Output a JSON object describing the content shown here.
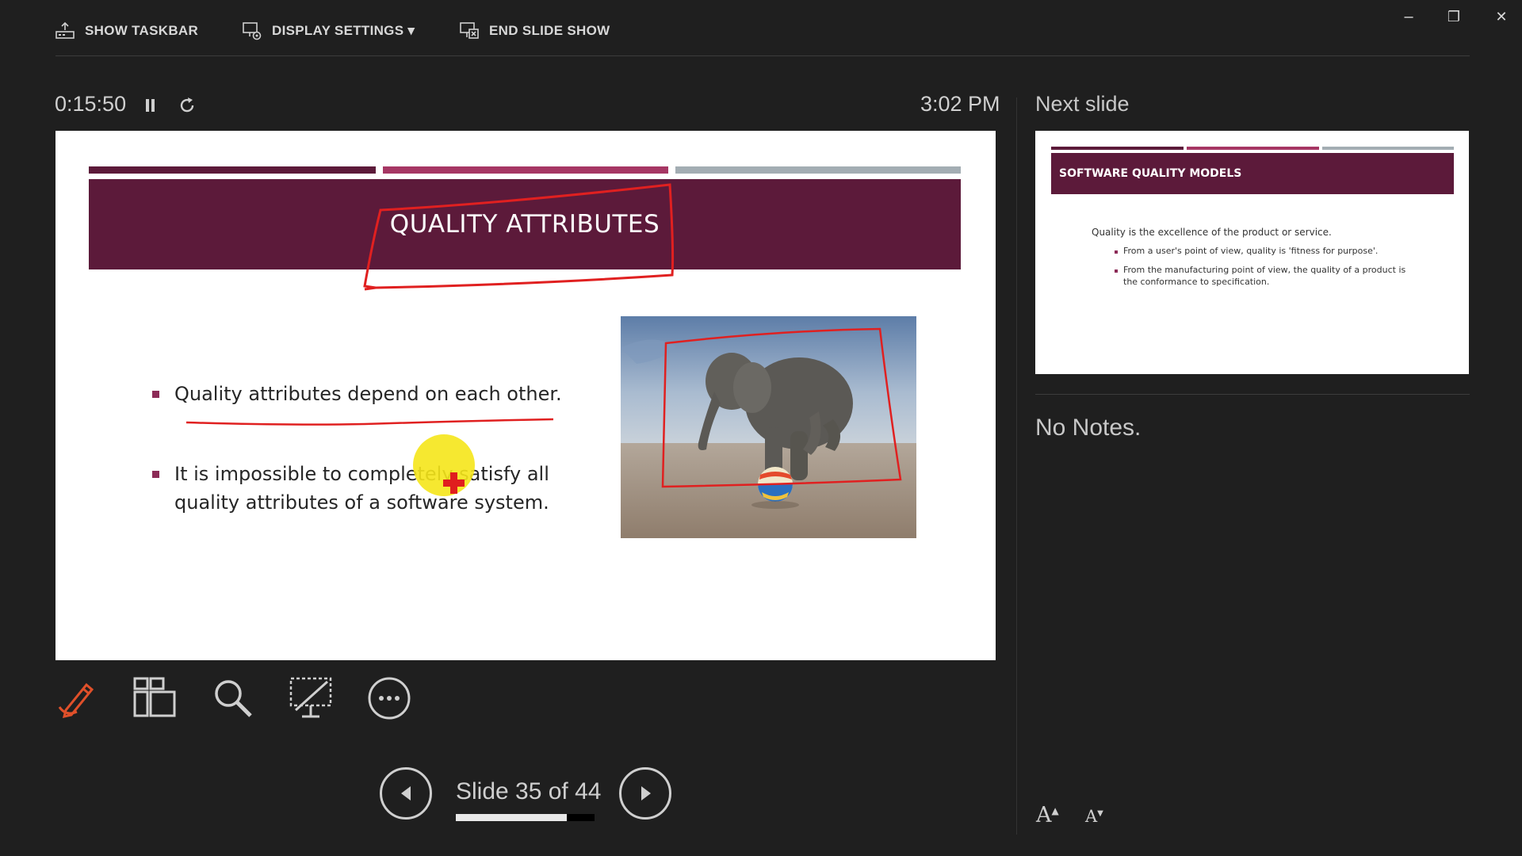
{
  "toolbar": {
    "show_taskbar": "SHOW TASKBAR",
    "display_settings": "DISPLAY SETTINGS ▾",
    "end_slide_show": "END SLIDE SHOW",
    "icons": [
      "taskbar-icon",
      "display-settings-icon",
      "end-slideshow-icon"
    ]
  },
  "window_controls": {
    "minimize": "–",
    "restore": "❐",
    "close": "✕"
  },
  "timer": {
    "elapsed": "0:15:50",
    "clock": "3:02 PM"
  },
  "current_slide": {
    "title": "QUALITY ATTRIBUTES",
    "bullets": [
      "Quality attributes depend on each other.",
      "It is impossible to completely satisfy all",
      "quality attributes of a software system."
    ],
    "image": "elephant-balancing-on-ball",
    "bar_colors": [
      "#5c1a3a",
      "#a63764",
      "#a3adb3"
    ],
    "ink_color": "#e02020",
    "pointer_highlight_color": "#f5e61a"
  },
  "next_slide": {
    "label": "Next slide",
    "title": "SOFTWARE QUALITY MODELS",
    "intro": "Quality is the excellence of the product or service.",
    "bullets": [
      "From a user's point of view, quality is 'fitness for purpose'.",
      "From the manufacturing point of view, the quality of a product is",
      "the conformance to specification."
    ]
  },
  "notes": "No Notes.",
  "bottom_tools": [
    "pen-laser-icon",
    "see-all-slides-icon",
    "zoom-icon",
    "black-screen-icon",
    "more-options-icon"
  ],
  "accent_color": "#e0502a",
  "navigation": {
    "slide_counter": "Slide 35 of 44",
    "current": 35,
    "total": 44,
    "progress": 0.8
  },
  "font_size_controls": {
    "increase": "A",
    "decrease": "A"
  }
}
